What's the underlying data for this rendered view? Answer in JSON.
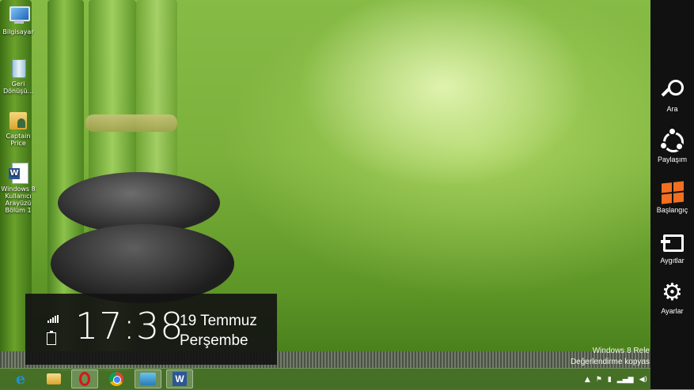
{
  "desktop": {
    "icons": [
      {
        "label": "Bilgisayar",
        "icon": "computer-icon"
      },
      {
        "label": "Geri Dönüşü...",
        "icon": "recycle-bin-icon"
      },
      {
        "label": "Captain Price",
        "icon": "user-folder-icon"
      },
      {
        "label": "Windows 8 Kullanıcı Arayüzü Bölüm 1",
        "icon": "word-document-icon"
      }
    ],
    "watermark_line1": "Windows 8 Rele",
    "watermark_line2": "Değerlendirme kopyas"
  },
  "clock": {
    "time": "17:38",
    "date": "19 Temmuz",
    "day": "Perşembe"
  },
  "charms": [
    {
      "label": "Ara",
      "icon": "search-icon"
    },
    {
      "label": "Paylaşım",
      "icon": "share-icon"
    },
    {
      "label": "Başlangıç",
      "icon": "windows-start-icon"
    },
    {
      "label": "Aygıtlar",
      "icon": "devices-icon"
    },
    {
      "label": "Ayarlar",
      "icon": "settings-gear-icon"
    }
  ],
  "taskbar": {
    "pinned": [
      {
        "app": "Internet Explorer",
        "icon": "internet-explorer-icon",
        "active": false
      },
      {
        "app": "File Explorer",
        "icon": "file-explorer-icon",
        "active": false
      },
      {
        "app": "Opera",
        "icon": "opera-icon",
        "active": true
      },
      {
        "app": "Google Chrome",
        "icon": "chrome-icon",
        "active": false
      },
      {
        "app": "Network",
        "icon": "network-icon",
        "active": true
      },
      {
        "app": "Microsoft Word",
        "icon": "word-icon",
        "active": true
      }
    ],
    "tray_icons": [
      "tray-overflow-icon",
      "flag-icon",
      "battery-icon",
      "signal-icon",
      "volume-icon"
    ]
  },
  "colors": {
    "charm_bar": "#111111",
    "start_accent": "#f26f21",
    "clock_panel": "#141414"
  }
}
